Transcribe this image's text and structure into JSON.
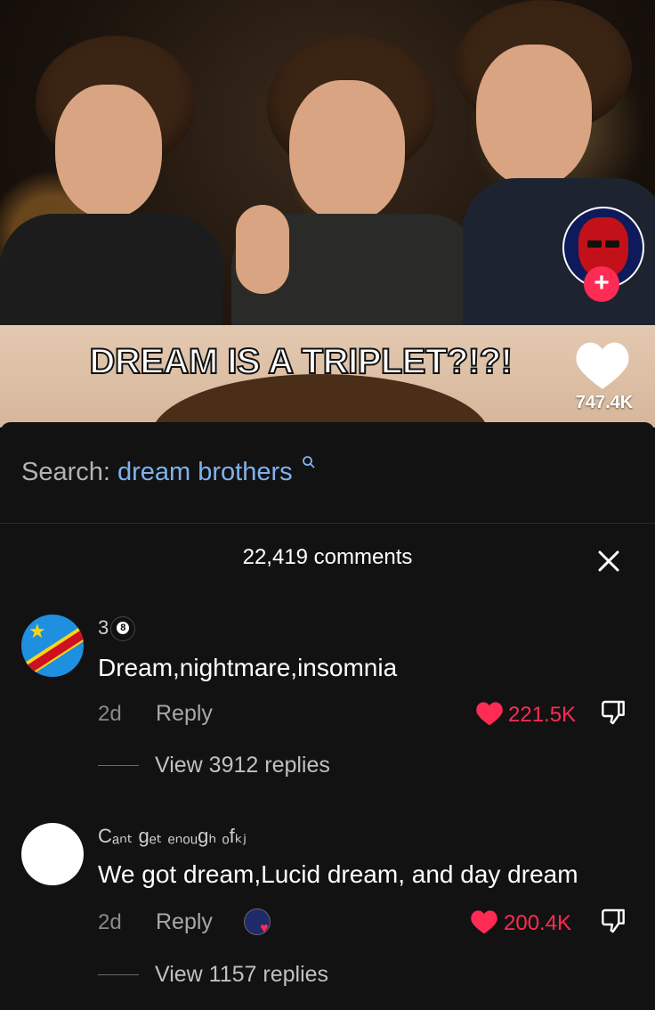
{
  "video": {
    "overlay_title": "DREAM IS A TRIPLET?!?!",
    "like_count": "747.4K",
    "follow_symbol": "+"
  },
  "sheet": {
    "search_label": "Search:",
    "search_term": "dream brothers",
    "comment_count": "22,419 comments",
    "close_symbol": "✕"
  },
  "comments": [
    {
      "username": "3",
      "username_emoji": "8",
      "text": "Dream,nightmare,insomnia",
      "time": "2d",
      "reply_label": "Reply",
      "likes": "221.5K",
      "view_replies": "View 3912 replies"
    },
    {
      "username": "Cₐₙₜ gₑₜ ₑₙₒᵤgₕ ₒfₖⱼ",
      "text": "We got dream,Lucid dream, and day dream",
      "time": "2d",
      "reply_label": "Reply",
      "likes": "200.4K",
      "view_replies": "View 1157 replies"
    }
  ],
  "colors": {
    "accent_red": "#fe2c55",
    "search_blue": "#7fb2ee",
    "sheet_bg": "#121212"
  }
}
